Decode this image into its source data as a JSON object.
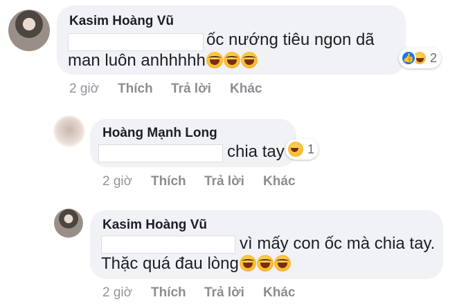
{
  "comments": [
    {
      "author": "Kasim Hoàng Vũ",
      "line1": "ốc nướng tiêu ngon dã",
      "line2": "man luôn anhhhhh",
      "reaction_count": "2",
      "time": "2 giờ",
      "like": "Thích",
      "reply": "Trả lời",
      "more": "Khác"
    },
    {
      "author": "Hoàng Mạnh Long",
      "line1": "chia tay",
      "reaction_count": "1",
      "time": "2 giờ",
      "like": "Thích",
      "reply": "Trả lời",
      "more": "Khác"
    },
    {
      "author": "Kasim Hoàng Vũ",
      "line1": "vì mấy con ốc mà chia tay.",
      "line2": "Thặc quá đau lòng",
      "time": "2 giờ",
      "like": "Thích",
      "reply": "Trả lời",
      "more": "Khác"
    }
  ],
  "icons": {
    "like": "thumbs-up-icon",
    "haha": "haha-emoji-icon",
    "rofl": "rofl-emoji-icon"
  },
  "colors": {
    "bubble": "#f1f2f6",
    "like_blue": "#1877f2",
    "meta_gray": "#90949c"
  }
}
